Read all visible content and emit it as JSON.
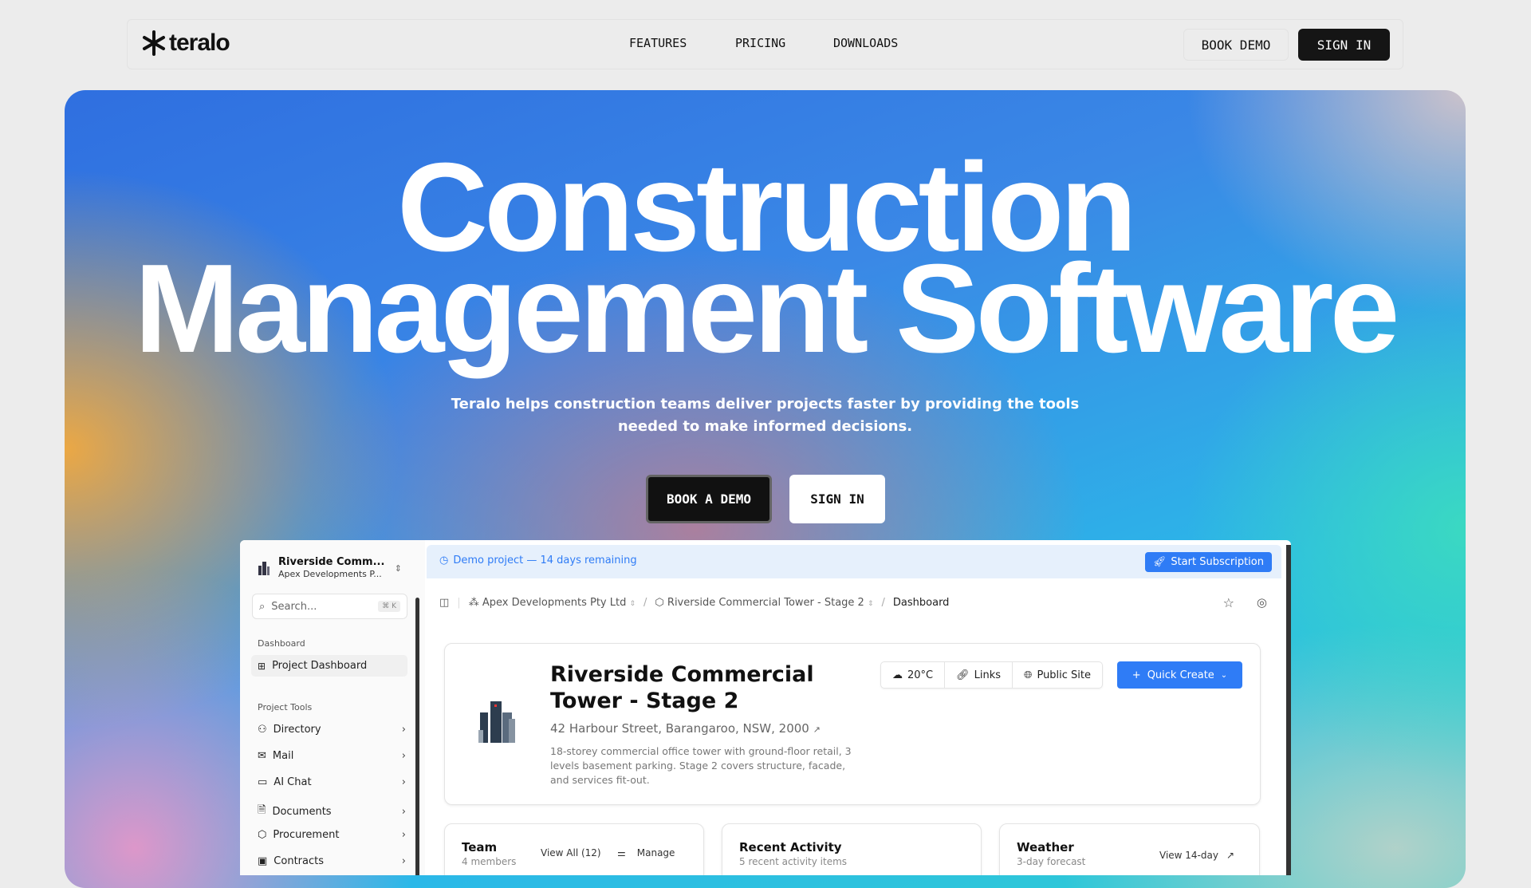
{
  "nav": {
    "brand": "teralo",
    "links": [
      "FEATURES",
      "PRICING",
      "DOWNLOADS"
    ],
    "book_demo": "BOOK DEMO",
    "sign_in": "SIGN IN"
  },
  "hero": {
    "title_line1": "Construction",
    "title_line2": "Management Software",
    "subtitle_line1": "Teralo helps construction teams deliver projects faster by providing the tools",
    "subtitle_line2": "needed to make informed decisions.",
    "book_demo": "BOOK A DEMO",
    "sign_in": "SIGN IN"
  },
  "app": {
    "sidebar": {
      "project_name": "Riverside Comm...",
      "org_name": "Apex Developments P...",
      "search_placeholder": "Search...",
      "search_shortcut": "⌘ K",
      "section_dashboard": "Dashboard",
      "dashboard_item": "Project Dashboard",
      "section_tools": "Project Tools",
      "items": [
        "Directory",
        "Mail",
        "AI Chat",
        "Documents",
        "Procurement",
        "Contracts"
      ]
    },
    "banner": {
      "text": "Demo project — 14 days remaining",
      "button": "Start Subscription"
    },
    "breadcrumb": {
      "org": "Apex Developments Pty Ltd",
      "project": "Riverside Commercial Tower - Stage 2",
      "page": "Dashboard"
    },
    "project": {
      "title_line1": "Riverside Commercial",
      "title_line2": "Tower - Stage 2",
      "address": "42 Harbour Street, Barangaroo, NSW, 2000",
      "description_lines": [
        "18-storey commercial office tower with ground-floor retail, 3",
        "levels basement parking. Stage 2 covers structure, facade,",
        "and services fit-out."
      ],
      "temperature": "20°C",
      "links": "Links",
      "public_site": "Public Site",
      "quick_create": "Quick Create"
    },
    "cards": [
      {
        "title": "Team",
        "subtitle": "4 members",
        "action1": "View All (12)",
        "action2": "Manage"
      },
      {
        "title": "Recent Activity",
        "subtitle": "5 recent activity items"
      },
      {
        "title": "Weather",
        "subtitle": "3-day forecast",
        "action1": "View 14-day"
      }
    ],
    "colors": {
      "accent": "#2f7cf6",
      "banner_bg": "#e6f0fc"
    }
  }
}
